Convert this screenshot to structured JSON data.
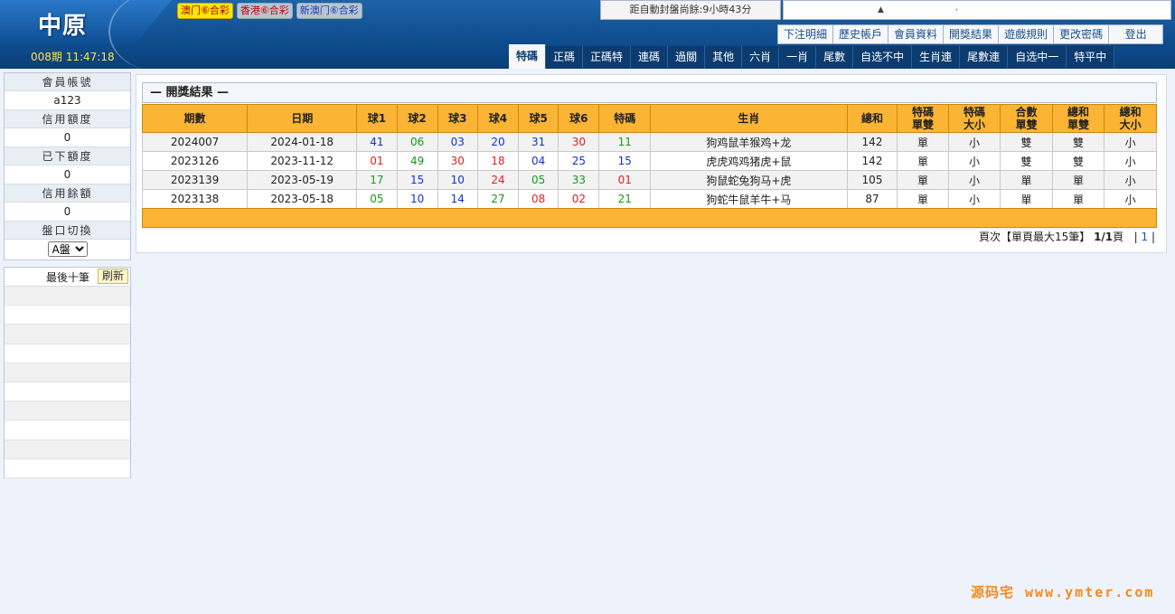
{
  "header": {
    "logo": "中原",
    "period_time": "008期 11:47:18",
    "games": [
      {
        "label": "澳门⑥合彩",
        "style": "active"
      },
      {
        "label": "香港⑥合彩",
        "style": "hk"
      },
      {
        "label": "新澳门⑥合彩",
        "style": "nm"
      }
    ],
    "countdown": "距自動封盤尚餘:9小時43分",
    "marquee_icon": "▲",
    "marquee_mark": "'"
  },
  "topnav": [
    "下注明細",
    "歷史帳戶",
    "會員資料",
    "開獎結果",
    "遊戲規則",
    "更改密碼",
    "登出"
  ],
  "tabs": [
    "特碼",
    "正碼",
    "正碼特",
    "連碼",
    "過關",
    "其他",
    "六肖",
    "一肖",
    "尾數",
    "自选不中",
    "生肖連",
    "尾數連",
    "自选中一",
    "特平中"
  ],
  "active_tab": 0,
  "sidebar": {
    "account_label": "會員帳號",
    "account_value": "a123",
    "credit_label": "信用額度",
    "credit_value": "0",
    "placed_label": "已下額度",
    "placed_value": "0",
    "balance_label": "信用餘額",
    "balance_value": "0",
    "switch_label": "盤口切換",
    "switch_value": "A盤",
    "last10_title": "最後十筆",
    "refresh_label": "刷新"
  },
  "results": {
    "title": "— 開獎結果 —",
    "headers": [
      "期數",
      "日期",
      "球1",
      "球2",
      "球3",
      "球4",
      "球5",
      "球6",
      "特碼",
      "生肖",
      "總和",
      "特碼\n單雙",
      "特碼\n大小",
      "合數\n單雙",
      "總和\n單雙",
      "總和\n大小"
    ],
    "rows": [
      {
        "period": "2024007",
        "date": "2024-01-18",
        "balls": [
          [
            "41",
            "blue"
          ],
          [
            "06",
            "green"
          ],
          [
            "03",
            "blue"
          ],
          [
            "20",
            "blue"
          ],
          [
            "31",
            "blue"
          ],
          [
            "30",
            "red"
          ],
          [
            "11",
            "green"
          ]
        ],
        "zodiac": "狗鸡鼠羊猴鸡+龙",
        "sum": "142",
        "sp_oe": "單",
        "sp_bs": "小",
        "comp_oe": "雙",
        "sum_oe": "雙",
        "sum_bs": "小"
      },
      {
        "period": "2023126",
        "date": "2023-11-12",
        "balls": [
          [
            "01",
            "red"
          ],
          [
            "49",
            "green"
          ],
          [
            "30",
            "red"
          ],
          [
            "18",
            "red"
          ],
          [
            "04",
            "blue"
          ],
          [
            "25",
            "blue"
          ],
          [
            "15",
            "blue"
          ]
        ],
        "zodiac": "虎虎鸡鸡猪虎+鼠",
        "sum": "142",
        "sp_oe": "單",
        "sp_bs": "小",
        "comp_oe": "雙",
        "sum_oe": "雙",
        "sum_bs": "小"
      },
      {
        "period": "2023139",
        "date": "2023-05-19",
        "balls": [
          [
            "17",
            "green"
          ],
          [
            "15",
            "blue"
          ],
          [
            "10",
            "blue"
          ],
          [
            "24",
            "red"
          ],
          [
            "05",
            "green"
          ],
          [
            "33",
            "green"
          ],
          [
            "01",
            "red"
          ]
        ],
        "zodiac": "狗鼠蛇兔狗马+虎",
        "sum": "105",
        "sp_oe": "單",
        "sp_bs": "小",
        "comp_oe": "單",
        "sum_oe": "單",
        "sum_bs": "小"
      },
      {
        "period": "2023138",
        "date": "2023-05-18",
        "balls": [
          [
            "05",
            "green"
          ],
          [
            "10",
            "blue"
          ],
          [
            "14",
            "blue"
          ],
          [
            "27",
            "green"
          ],
          [
            "08",
            "red"
          ],
          [
            "02",
            "red"
          ],
          [
            "21",
            "green"
          ]
        ],
        "zodiac": "狗蛇牛鼠羊牛+马",
        "sum": "87",
        "sp_oe": "單",
        "sp_bs": "小",
        "comp_oe": "單",
        "sum_oe": "單",
        "sum_bs": "小"
      }
    ],
    "pager_prefix": "頁次【單頁最大15筆】",
    "pager_pages": "1/1",
    "pager_suffix": "頁",
    "pager_link": "1"
  },
  "watermark": {
    "brand": "源码宅",
    "url": "www.ymter.com"
  }
}
